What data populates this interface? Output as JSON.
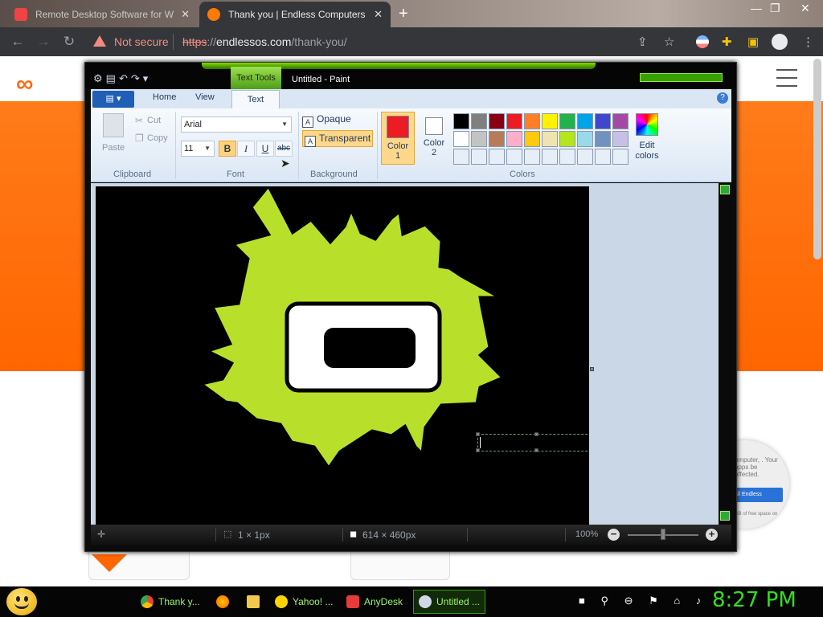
{
  "browser": {
    "tabs": [
      {
        "label": "Remote Desktop Software for W",
        "close": "✕"
      },
      {
        "label": "Thank you | Endless Computers",
        "close": "✕"
      }
    ],
    "new_tab": "+",
    "window_controls": [
      "—",
      "❐",
      "✕"
    ],
    "security_text": "Not secure",
    "url_scheme": "https",
    "url_rest": "://",
    "url_host": "endlessos.com",
    "url_path": "/thank-you/"
  },
  "site": {
    "logo": "∞",
    "popup_text": "omputer, . Your apps be affected.",
    "popup_button": "all Endless",
    "popup_note": "GB of free space on"
  },
  "paint": {
    "contextual_tab": "Text Tools",
    "title": "Untitled - Paint",
    "tabs": {
      "file": "▤ ▾",
      "home": "Home",
      "view": "View",
      "text": "Text"
    },
    "help": "?",
    "clipboard": {
      "paste": "Paste",
      "cut": "Cut",
      "copy": "Copy",
      "label": "Clipboard"
    },
    "font": {
      "family": "Arial",
      "size": "11",
      "bold": "B",
      "italic": "I",
      "underline": "U",
      "strike": "abc",
      "label": "Font"
    },
    "background": {
      "opaque": "Opaque",
      "transparent": "Transparent",
      "label": "Background"
    },
    "colors": {
      "color1_line1": "Color",
      "color1_line2": "1",
      "color2_line1": "Color",
      "color2_line2": "2",
      "edit_line1": "Edit",
      "edit_line2": "colors",
      "label": "Colors",
      "color1": "#ED1C24",
      "color2": "#FFFFFF",
      "palette": [
        "#000000",
        "#7F7F7F",
        "#880015",
        "#ED1C24",
        "#FF7F27",
        "#FFF200",
        "#22B14C",
        "#00A2E8",
        "#3F48CC",
        "#A349A4",
        "#FFFFFF",
        "#C3C3C3",
        "#B97A57",
        "#FFAEC9",
        "#FFC90E",
        "#EFE4B0",
        "#B5E61D",
        "#99D9EA",
        "#7092BE",
        "#C8BFE7",
        "#E6EEF7",
        "#E6EEF7",
        "#E6EEF7",
        "#E6EEF7",
        "#E6EEF7",
        "#E6EEF7",
        "#E6EEF7",
        "#E6EEF7",
        "#E6EEF7",
        "#E6EEF7"
      ]
    },
    "status": {
      "selection": "1 × 1px",
      "canvas_size": "614 × 460px",
      "zoom": "100%"
    },
    "drawing": {
      "starburst": "#B8E02A",
      "outline": "#000000",
      "inner": "#FFFFFF",
      "background": "#000000"
    }
  },
  "taskbar": {
    "items": [
      "Thank y...",
      "Yahoo! ...",
      "AnyDesk",
      "Untitled ..."
    ],
    "tray": "■ ⚲ ⊖ ⚑ ⌂ ♪",
    "clock": "8:27 PM"
  }
}
